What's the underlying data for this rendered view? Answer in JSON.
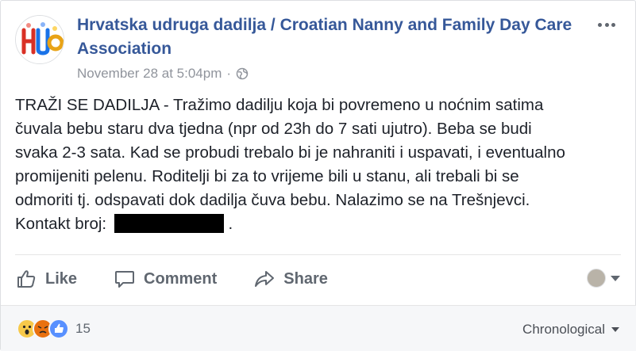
{
  "post": {
    "page_name": "Hrvatska udruga dadilja / Croatian Nanny and Family Day Care Association",
    "timestamp": "November 28 at 5:04pm",
    "separator": "·",
    "privacy_icon": "globe-icon",
    "more_icon": "more-options-icon",
    "text_lines": [
      "TRAŽI SE DADILJA - Tražimo dadilju koja bi povremeno u noćnim satima",
      "čuvala bebu staru dva tjedna (npr od 23h do 7 sati ujutro). Beba se budi",
      "svaka 2-3 sata. Kad se probudi trebalo bi je nahraniti i uspavati, i eventualno",
      "promijeniti pelenu. Roditelji bi za to vrijeme bili u stanu, ali trebali bi se",
      "odmoriti tj. odspavati dok dadilja čuva bebu. Nalazimo se na Trešnjevci."
    ],
    "contact_label": "Kontakt broj:",
    "contact_end": "."
  },
  "actions": {
    "like": "Like",
    "comment": "Comment",
    "share": "Share"
  },
  "footer": {
    "reaction_count": "15",
    "reaction_icons": [
      "wow-icon",
      "angry-icon",
      "like-icon"
    ],
    "sort_label": "Chronological"
  },
  "colors": {
    "link": "#365899",
    "meta": "#90949c",
    "action": "#606770",
    "like_blue": "#5890ff"
  }
}
